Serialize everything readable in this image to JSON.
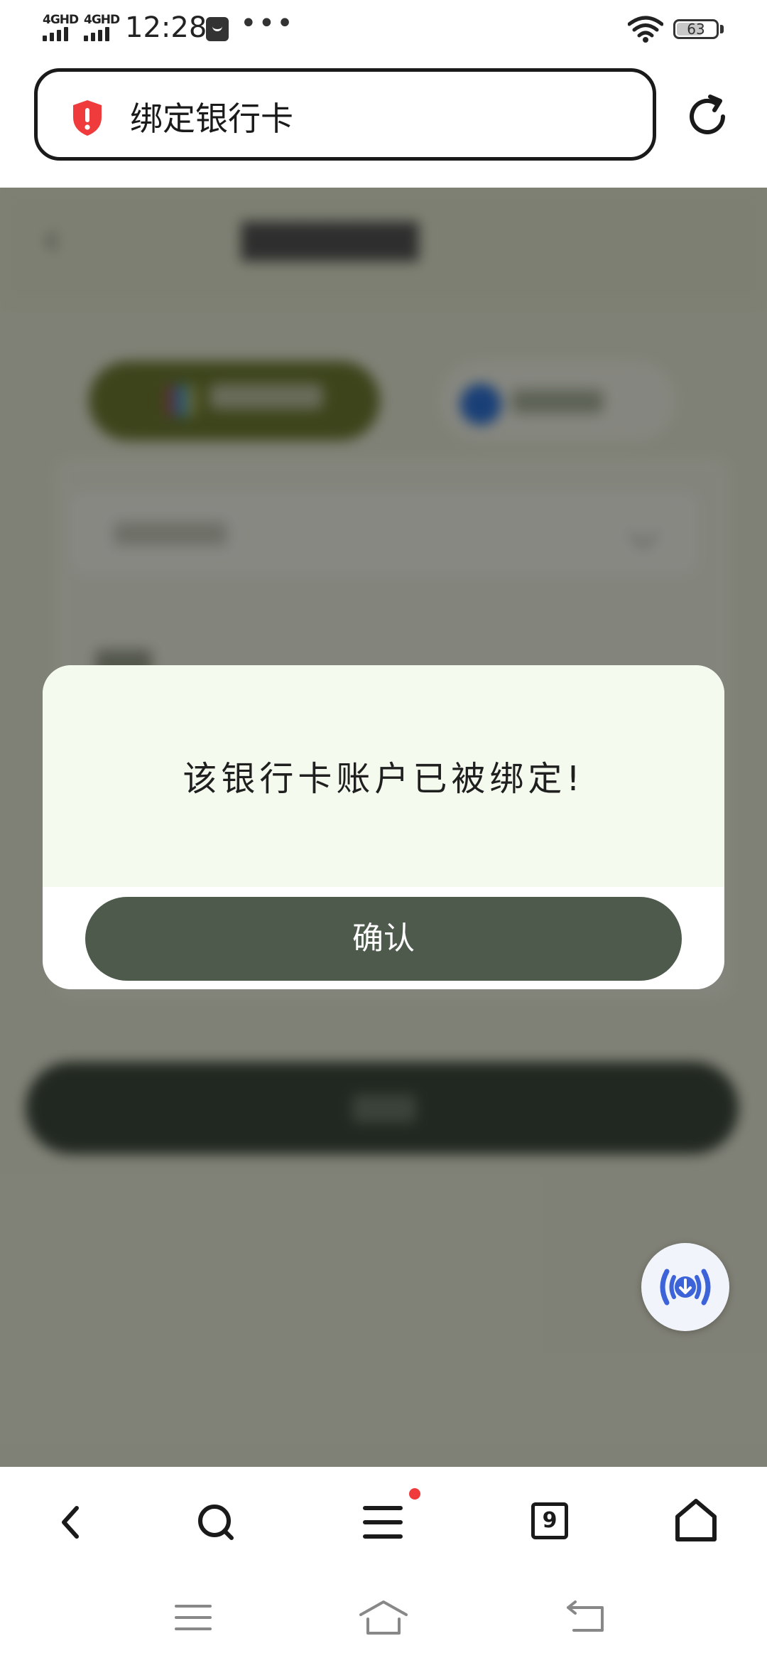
{
  "status_bar": {
    "signal_1": "4GHD",
    "signal_2": "4GHD",
    "time": "12:28",
    "more": "•••",
    "battery": "63"
  },
  "address_bar": {
    "title": "绑定银行卡",
    "security_icon": "shield-alert-icon",
    "reload_icon": "reload-icon"
  },
  "dialog": {
    "message": "该银行卡账户已被绑定!",
    "confirm_label": "确认"
  },
  "toolbar": {
    "tabs_count": "9",
    "icons": [
      "back-icon",
      "search-icon",
      "menu-icon",
      "tabs-icon",
      "home-icon"
    ],
    "menu_has_notification": true
  },
  "system_nav": {
    "icons": [
      "recents-icon",
      "home-icon",
      "back-icon"
    ]
  },
  "colors": {
    "confirm_button": "#4d5a4c",
    "dialog_header": "#f4fbee",
    "shield": "#ef3b3b",
    "fab_icon": "#3c63d8"
  }
}
